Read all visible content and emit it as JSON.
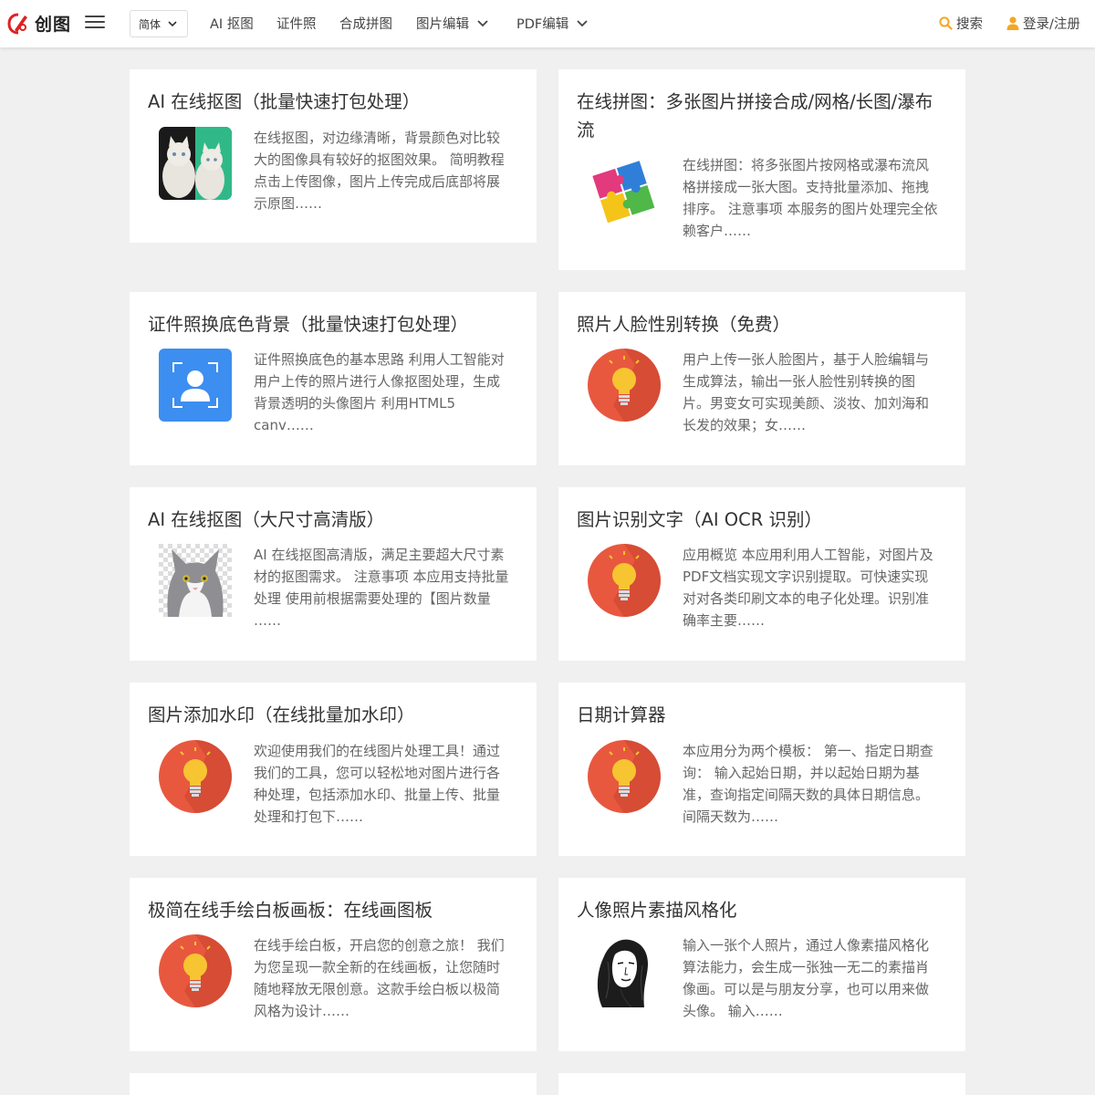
{
  "header": {
    "logo_text": "创图",
    "lang": "简体",
    "nav": [
      "AI 抠图",
      "证件照",
      "合成拼图",
      "图片编辑",
      "PDF编辑"
    ],
    "search_label": "搜索",
    "login_label": "登录/注册"
  },
  "colors": {
    "accent": "#f5a623",
    "logo_red": "#e02020",
    "card_bg": "#ffffff",
    "page_bg": "#f0f0f0"
  },
  "cards": [
    {
      "title": "AI 在线抠图（批量快速打包处理）",
      "desc": "在线抠图，对边缘清晰，背景颜色对比较大的图像具有较好的抠图效果。 简明教程 点击上传图像，图片上传完成后底部将展示原图……",
      "icon": "cat-cutout-icon"
    },
    {
      "title": "在线拼图：多张图片拼接合成/网格/长图/瀑布流",
      "desc": "在线拼图：将多张图片按网格或瀑布流风格拼接成一张大图。支持批量添加、拖拽排序。 注意事项 本服务的图片处理完全依赖客户……",
      "icon": "puzzle-icon"
    },
    {
      "title": "证件照换底色背景（批量快速打包处理）",
      "desc": "证件照换底色的基本思路 利用人工智能对用户上传的照片进行人像抠图处理，生成背景透明的头像图片 利用HTML5 canv……",
      "icon": "id-photo-icon"
    },
    {
      "title": "照片人脸性别转换（免费）",
      "desc": "用户上传一张人脸图片，基于人脸编辑与生成算法，输出一张人脸性别转换的图片。男变女可实现美颜、淡妆、加刘海和长发的效果；女……",
      "icon": "lightbulb-icon"
    },
    {
      "title": "AI 在线抠图（大尺寸高清版）",
      "desc": "AI 在线抠图高清版，满足主要超大尺寸素材的抠图需求。 注意事项 本应用支持批量处理 使用前根据需要处理的【图片数量 ……",
      "icon": "cat-hd-icon"
    },
    {
      "title": "图片识别文字（AI OCR 识别）",
      "desc": "应用概览 本应用利用人工智能，对图片及PDF文档实现文字识别提取。可快速实现对对各类印刷文本的电子化处理。识别准确率主要……",
      "icon": "lightbulb-icon"
    },
    {
      "title": "图片添加水印（在线批量加水印）",
      "desc": "欢迎使用我们的在线图片处理工具！通过我们的工具，您可以轻松地对图片进行各种处理，包括添加水印、批量上传、批量处理和打包下……",
      "icon": "lightbulb-icon"
    },
    {
      "title": "日期计算器",
      "desc": "本应用分为两个模板： 第一、指定日期查询： 输入起始日期，并以起始日期为基准，查询指定间隔天数的具体日期信息。间隔天数为……",
      "icon": "lightbulb-icon"
    },
    {
      "title": "极简在线手绘白板画板：在线画图板",
      "desc": "在线手绘白板，开启您的创意之旅！ 我们为您呈现一款全新的在线画板，让您随时随地释放无限创意。这款手绘白板以极简风格为设计……",
      "icon": "lightbulb-icon"
    },
    {
      "title": "人像照片素描风格化",
      "desc": "输入一张个人照片，通过人像素描风格化算法能力，会生成一张独一无二的素描肖像画。可以是与朋友分享，也可以用来做头像。 输入……",
      "icon": "portrait-sketch-icon"
    }
  ]
}
